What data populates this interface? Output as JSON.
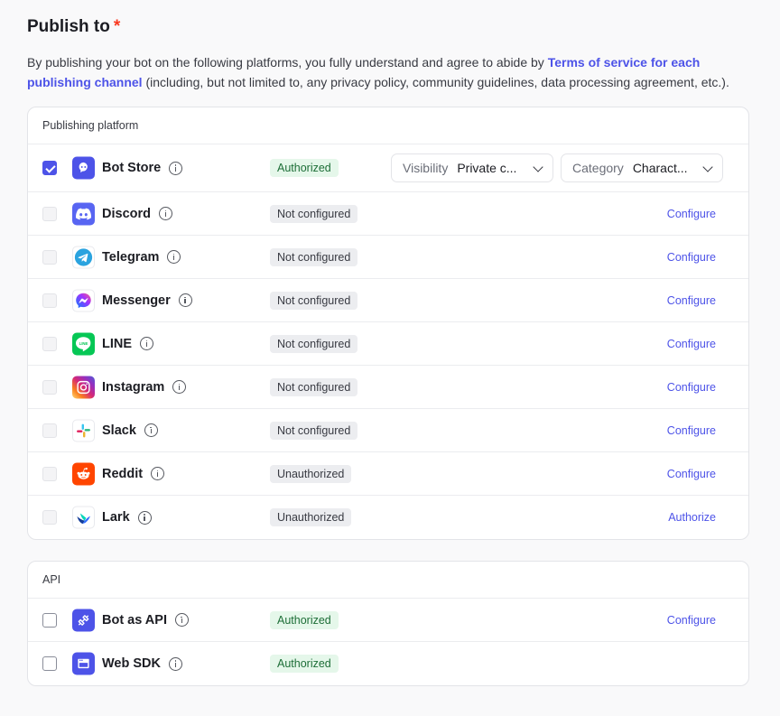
{
  "section": {
    "title": "Publish to",
    "required_mark": "*",
    "desc_before": "By publishing your bot on the following platforms, you fully understand and agree to abide by ",
    "desc_link": "Terms of service for each publishing channel",
    "desc_after": " (including, but not limited to, any privacy policy, community guidelines, data processing agreement, etc.)."
  },
  "platforms": {
    "header": "Publishing platform",
    "rows": [
      {
        "name": "Bot Store",
        "status": "Authorized",
        "action": ""
      },
      {
        "name": "Discord",
        "status": "Not configured",
        "action": "Configure"
      },
      {
        "name": "Telegram",
        "status": "Not configured",
        "action": "Configure"
      },
      {
        "name": "Messenger",
        "status": "Not configured",
        "action": "Configure"
      },
      {
        "name": "LINE",
        "status": "Not configured",
        "action": "Configure"
      },
      {
        "name": "Instagram",
        "status": "Not configured",
        "action": "Configure"
      },
      {
        "name": "Slack",
        "status": "Not configured",
        "action": "Configure"
      },
      {
        "name": "Reddit",
        "status": "Unauthorized",
        "action": "Configure"
      },
      {
        "name": "Lark",
        "status": "Unauthorized",
        "action": "Authorize"
      }
    ],
    "bot_store": {
      "visibility_label": "Visibility",
      "visibility_value": "Private c...",
      "category_label": "Category",
      "category_value": "Charact..."
    }
  },
  "api": {
    "header": "API",
    "rows": [
      {
        "name": "Bot as API",
        "status": "Authorized",
        "action": "Configure"
      },
      {
        "name": "Web SDK",
        "status": "Authorized",
        "action": ""
      }
    ]
  },
  "colors": {
    "accent": "#4d53e8",
    "required": "#f93920",
    "authorized_bg": "#e5f7ea",
    "authorized_text": "#1d6e37"
  },
  "icons": [
    "bot-store-icon",
    "discord-icon",
    "telegram-icon",
    "messenger-icon",
    "line-icon",
    "instagram-icon",
    "slack-icon",
    "reddit-icon",
    "lark-icon",
    "bot-as-api-icon",
    "web-sdk-icon",
    "info-icon",
    "chevron-down-icon",
    "checkbox-check-icon"
  ]
}
